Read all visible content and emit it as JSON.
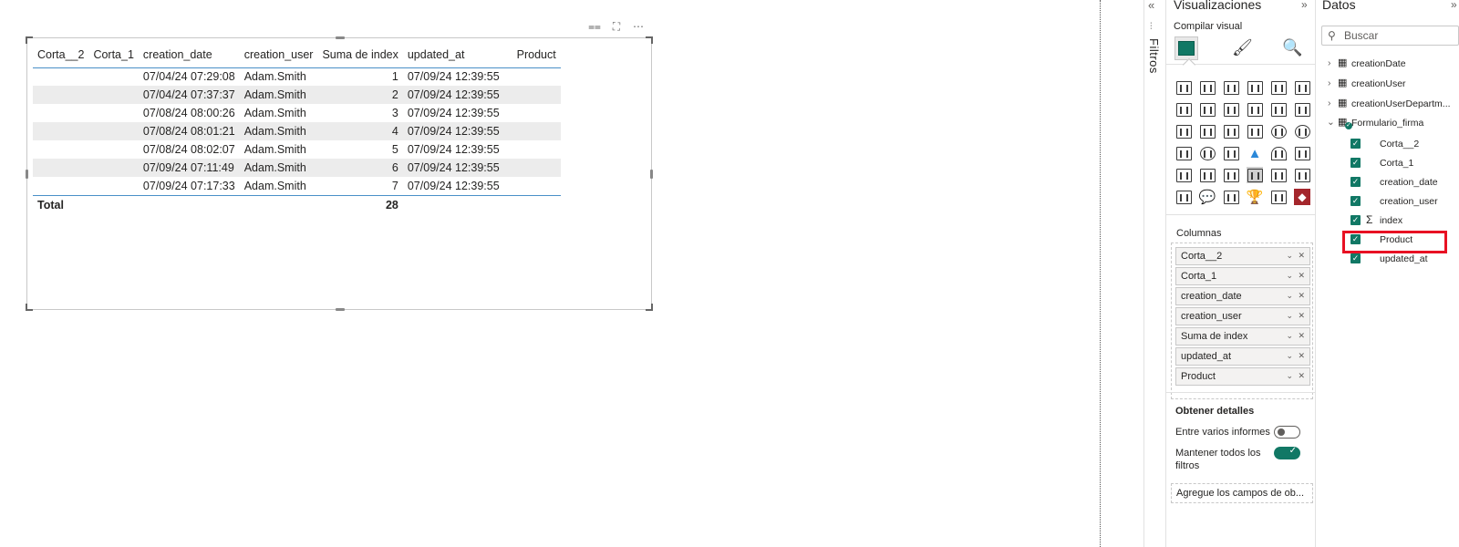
{
  "table": {
    "columns": [
      "Corta__2",
      "Corta_1",
      "creation_date",
      "creation_user",
      "Suma de index",
      "updated_at",
      "Product"
    ],
    "rows": [
      {
        "corta2": "",
        "corta1": "",
        "creation_date": "07/04/24 07:29:08",
        "creation_user": "Adam.Smith",
        "index": "1",
        "updated_at": "07/09/24 12:39:55",
        "product": ""
      },
      {
        "corta2": "",
        "corta1": "",
        "creation_date": "07/04/24 07:37:37",
        "creation_user": "Adam.Smith",
        "index": "2",
        "updated_at": "07/09/24 12:39:55",
        "product": ""
      },
      {
        "corta2": "",
        "corta1": "",
        "creation_date": "07/08/24 08:00:26",
        "creation_user": "Adam.Smith",
        "index": "3",
        "updated_at": "07/09/24 12:39:55",
        "product": ""
      },
      {
        "corta2": "",
        "corta1": "",
        "creation_date": "07/08/24 08:01:21",
        "creation_user": "Adam.Smith",
        "index": "4",
        "updated_at": "07/09/24 12:39:55",
        "product": ""
      },
      {
        "corta2": "",
        "corta1": "",
        "creation_date": "07/08/24 08:02:07",
        "creation_user": "Adam.Smith",
        "index": "5",
        "updated_at": "07/09/24 12:39:55",
        "product": ""
      },
      {
        "corta2": "",
        "corta1": "",
        "creation_date": "07/09/24 07:11:49",
        "creation_user": "Adam.Smith",
        "index": "6",
        "updated_at": "07/09/24 12:39:55",
        "product": ""
      },
      {
        "corta2": "",
        "corta1": "",
        "creation_date": "07/09/24 07:17:33",
        "creation_user": "Adam.Smith",
        "index": "7",
        "updated_at": "07/09/24 12:39:55",
        "product": ""
      }
    ],
    "total_label": "Total",
    "total_value": "28"
  },
  "filters": {
    "label": "Filtros"
  },
  "viz": {
    "title": "Visualizaciones",
    "build_label": "Compilar visual",
    "columns_label": "Columnas",
    "wells": [
      "Corta__2",
      "Corta_1",
      "creation_date",
      "creation_user",
      "Suma de index",
      "updated_at",
      "Product"
    ],
    "drill_label": "Obtener detalles",
    "cross_report_label": "Entre varios informes",
    "keep_filters_label_1": "Mantener todos los",
    "keep_filters_label_2": "filtros",
    "add_fields_placeholder": "Agregue los campos de ob..."
  },
  "data": {
    "title": "Datos",
    "search_placeholder": "Buscar",
    "tables": [
      "creationDate",
      "creationUser",
      "creationUserDepartm...",
      "Formulario_firma"
    ],
    "fields": [
      "Corta__2",
      "Corta_1",
      "creation_date",
      "creation_user",
      "index",
      "Product",
      "updated_at"
    ]
  },
  "colors": {
    "accent": "#117865",
    "highlight": "#e81123",
    "divider": "#4a90c8"
  }
}
